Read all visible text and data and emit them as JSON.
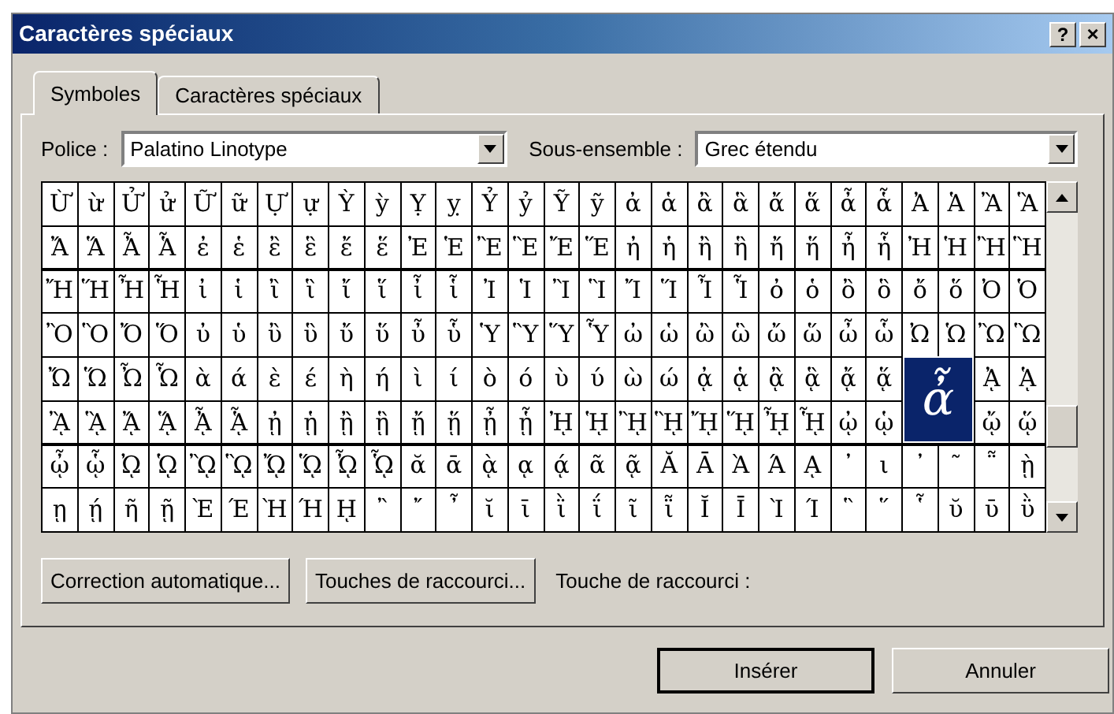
{
  "window": {
    "title": "Caractères spéciaux",
    "help_button": "?",
    "close_button": "×"
  },
  "tabs": [
    {
      "label": "Symboles",
      "selected": true
    },
    {
      "label": "Caractères spéciaux",
      "selected": false
    }
  ],
  "font_field": {
    "label": "Police :",
    "value": "Palatino Linotype"
  },
  "subset_field": {
    "label": "Sous-ensemble :",
    "value": "Grec étendu"
  },
  "grid": {
    "rows": [
      [
        "Ừ",
        "ừ",
        "Ử",
        "ử",
        "Ữ",
        "ữ",
        "Ự",
        "ự",
        "Ỳ",
        "ỳ",
        "Ỵ",
        "ỵ",
        "Ỷ",
        "ỷ",
        "Ỹ",
        "ỹ",
        "ἀ",
        "ἁ",
        "ἂ",
        "ἃ",
        "ἄ",
        "ἅ",
        "ἆ",
        "ἇ",
        "Ἀ",
        "Ἁ",
        "Ἂ",
        "Ἃ"
      ],
      [
        "Ἄ",
        "Ἅ",
        "Ἆ",
        "Ἇ",
        "ἐ",
        "ἑ",
        "ἒ",
        "ἓ",
        "ἔ",
        "ἕ",
        "Ἐ",
        "Ἑ",
        "Ἒ",
        "Ἓ",
        "Ἔ",
        "Ἕ",
        "ἠ",
        "ἡ",
        "ἢ",
        "ἣ",
        "ἤ",
        "ἥ",
        "ἦ",
        "ἧ",
        "Ἠ",
        "Ἡ",
        "Ἢ",
        "Ἣ"
      ],
      [
        "Ἤ",
        "Ἥ",
        "Ἦ",
        "Ἧ",
        "ἰ",
        "ἱ",
        "ἲ",
        "ἳ",
        "ἴ",
        "ἵ",
        "ἶ",
        "ἷ",
        "Ἰ",
        "Ἱ",
        "Ἲ",
        "Ἳ",
        "Ἴ",
        "Ἵ",
        "Ἶ",
        "Ἷ",
        "ὀ",
        "ὁ",
        "ὂ",
        "ὃ",
        "ὄ",
        "ὅ",
        "Ὀ",
        "Ὁ"
      ],
      [
        "Ὂ",
        "Ὃ",
        "Ὄ",
        "Ὅ",
        "ὐ",
        "ὑ",
        "ὒ",
        "ὓ",
        "ὔ",
        "ὕ",
        "ὖ",
        "ὗ",
        "Ὑ",
        "Ὓ",
        "Ὕ",
        "Ὗ",
        "ὠ",
        "ὡ",
        "ὢ",
        "ὣ",
        "ὤ",
        "ὥ",
        "ὦ",
        "ὧ",
        "Ὠ",
        "Ὡ",
        "Ὢ",
        "Ὣ"
      ],
      [
        "Ὤ",
        "Ὥ",
        "Ὦ",
        "Ὧ",
        "ὰ",
        "ά",
        "ὲ",
        "έ",
        "ὴ",
        "ή",
        "ὶ",
        "ί",
        "ὸ",
        "ό",
        "ὺ",
        "ύ",
        "ὼ",
        "ώ",
        "ᾀ",
        "ᾁ",
        "ᾂ",
        "ᾃ",
        "ᾄ",
        "ᾅ",
        null,
        null,
        "ᾈ",
        "ᾉ"
      ],
      [
        "ᾊ",
        "ᾋ",
        "ᾌ",
        "ᾍ",
        "ᾎ",
        "ᾏ",
        "ᾐ",
        "ᾑ",
        "ᾒ",
        "ᾓ",
        "ᾔ",
        "ᾕ",
        "ᾖ",
        "ᾗ",
        "ᾘ",
        "ᾙ",
        "ᾚ",
        "ᾛ",
        "ᾜ",
        "ᾝ",
        "ᾞ",
        "ᾟ",
        "ᾠ",
        "ᾡ",
        null,
        null,
        "ᾤ",
        "ᾥ"
      ],
      [
        "ᾦ",
        "ᾧ",
        "ᾨ",
        "ᾩ",
        "ᾪ",
        "ᾫ",
        "ᾬ",
        "ᾭ",
        "ᾮ",
        "ᾯ",
        "ᾰ",
        "ᾱ",
        "ᾲ",
        "ᾳ",
        "ᾴ",
        "ᾶ",
        "ᾷ",
        "Ᾰ",
        "Ᾱ",
        "Ὰ",
        "Ά",
        "ᾼ",
        "᾽",
        "ι",
        "᾿",
        "῀",
        "῁",
        "ῂ"
      ],
      [
        "ῃ",
        "ῄ",
        "ῆ",
        "ῇ",
        "Ὲ",
        "Έ",
        "Ὴ",
        "Ή",
        "ῌ",
        "῍",
        "῎",
        "῏",
        "ῐ",
        "ῑ",
        "ῒ",
        "ΐ",
        "ῖ",
        "ῗ",
        "Ῐ",
        "Ῑ",
        "Ὶ",
        "Ί",
        "῝",
        "῞",
        "῟",
        "ῠ",
        "ῡ",
        "ῢ"
      ]
    ],
    "preview": {
      "glyph": "ἆ"
    }
  },
  "autocorrect_button": "Correction automatique...",
  "shortcut_button": "Touches de raccourci...",
  "shortcut_label": "Touche de raccourci :",
  "buttons": [
    "Insérer",
    "Annuler"
  ]
}
